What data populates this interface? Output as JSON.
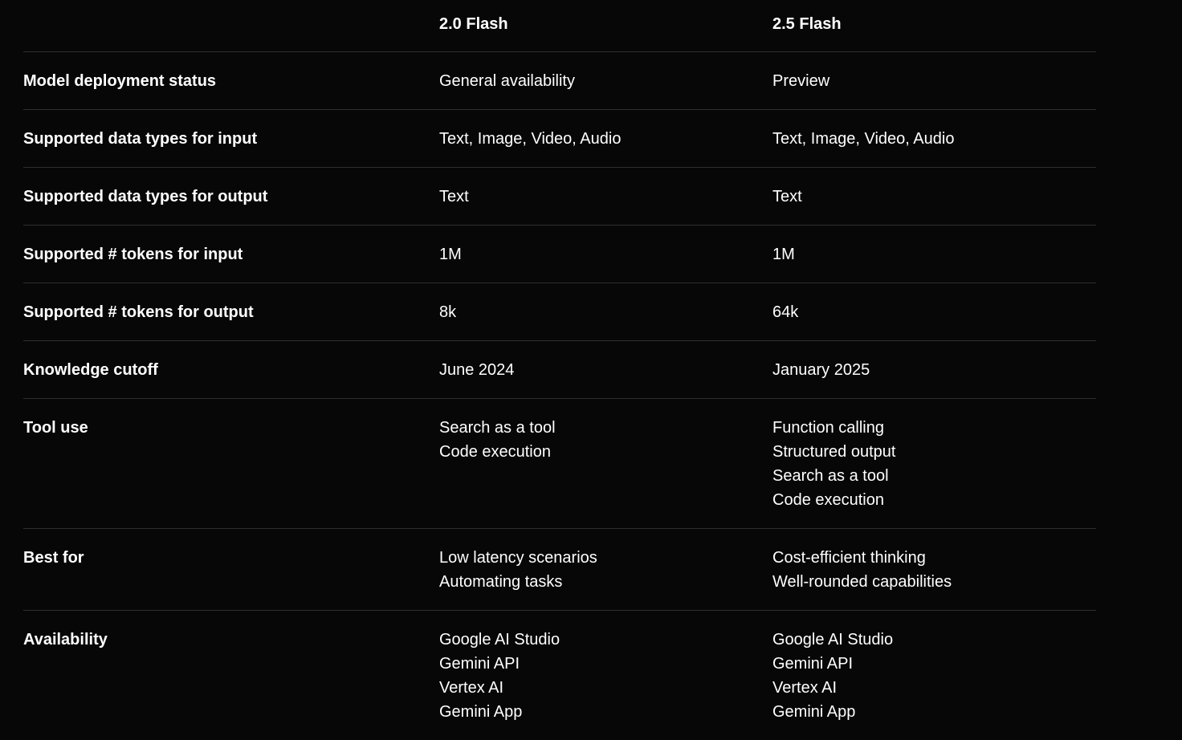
{
  "columns": [
    "",
    "2.0 Flash",
    "2.5 Flash"
  ],
  "rows": [
    {
      "label": "Model deployment status",
      "c1": [
        "General availability"
      ],
      "c2": [
        "Preview"
      ]
    },
    {
      "label": "Supported data types for input",
      "c1": [
        "Text, Image, Video, Audio"
      ],
      "c2": [
        "Text, Image, Video, Audio"
      ]
    },
    {
      "label": "Supported data types for output",
      "c1": [
        "Text"
      ],
      "c2": [
        "Text"
      ]
    },
    {
      "label": "Supported # tokens for input",
      "c1": [
        "1M"
      ],
      "c2": [
        "1M"
      ]
    },
    {
      "label": "Supported # tokens for output",
      "c1": [
        "8k"
      ],
      "c2": [
        "64k"
      ]
    },
    {
      "label": "Knowledge cutoff",
      "c1": [
        "June 2024"
      ],
      "c2": [
        "January 2025"
      ]
    },
    {
      "label": "Tool use",
      "c1": [
        "Search as a tool",
        "Code execution"
      ],
      "c2": [
        "Function calling",
        "Structured output",
        "Search as a tool",
        "Code execution"
      ]
    },
    {
      "label": "Best for",
      "c1": [
        "Low latency scenarios",
        "Automating tasks"
      ],
      "c2": [
        "Cost-efficient thinking",
        "Well-rounded capabilities"
      ]
    },
    {
      "label": "Availability",
      "c1": [
        "Google AI Studio",
        "Gemini API",
        "Vertex AI",
        "Gemini App"
      ],
      "c2": [
        "Google AI Studio",
        "Gemini API",
        "Vertex AI",
        "Gemini App"
      ]
    }
  ]
}
